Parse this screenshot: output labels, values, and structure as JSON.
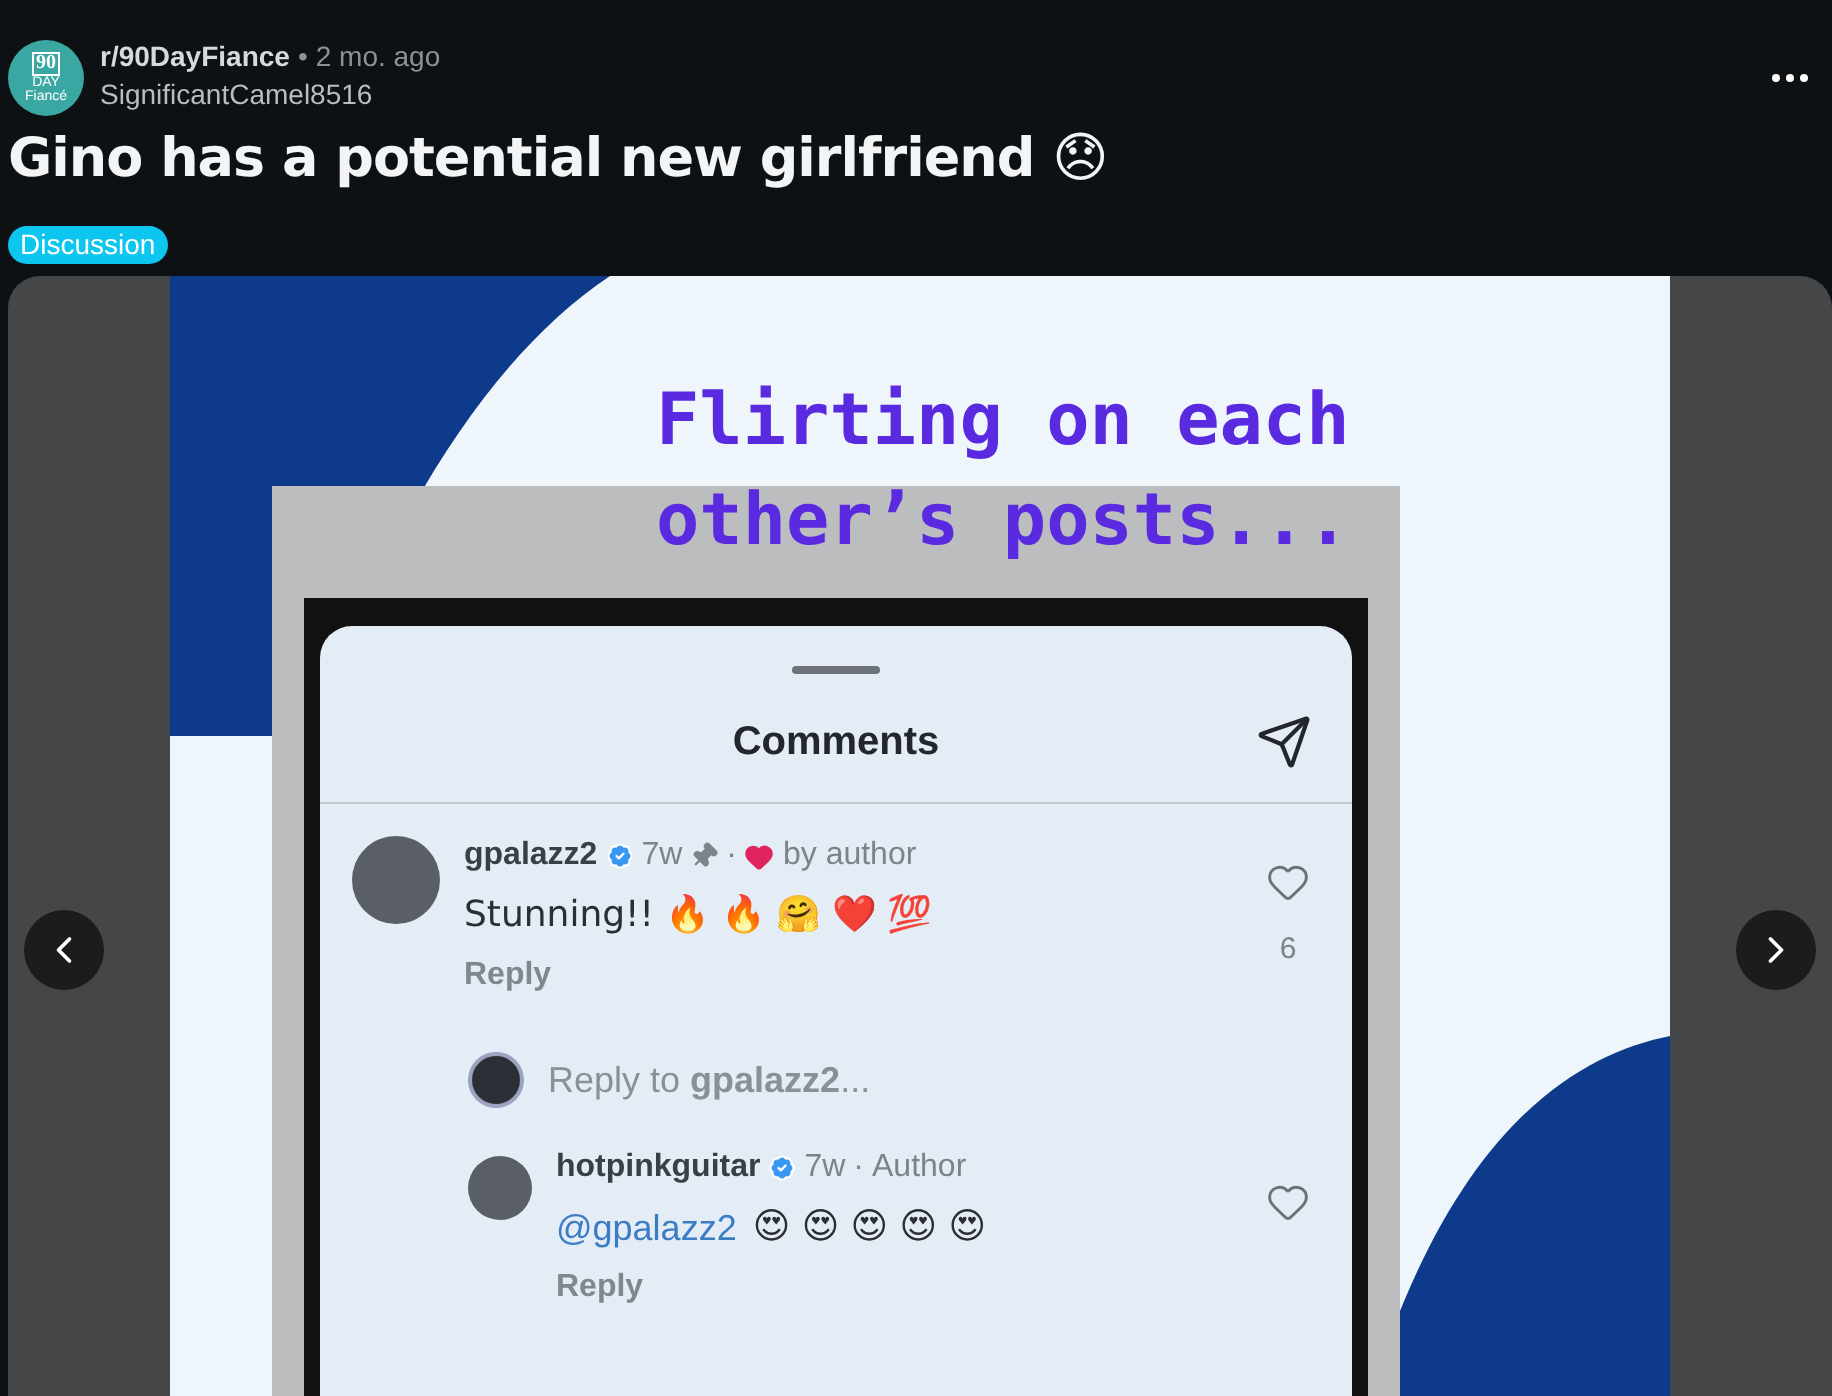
{
  "post": {
    "community_icon": {
      "lines": [
        "90",
        "DAY",
        "Fiancé"
      ]
    },
    "subreddit": "r/90DayFiance",
    "separator": "•",
    "time": "2 mo. ago",
    "author": "SignificantCamel8516",
    "title": "Gino has a potential new girlfriend 😞",
    "flair": "Discussion"
  },
  "carousel": {
    "headline": [
      "Flirting on each",
      "other’s posts..."
    ],
    "sheet": {
      "title": "Comments",
      "items": [
        {
          "kind": "comment",
          "user": "gpalazz2",
          "verified": true,
          "time": "7w",
          "pinned": true,
          "separator": "·",
          "liked_by_author": true,
          "label": "by author",
          "text": "Stunning!! 🔥 🔥 🤗 ❤️ 💯",
          "action": "Reply",
          "like_count": "6"
        },
        {
          "kind": "reply_field",
          "placeholder": "Reply to **gpalazz2**..."
        },
        {
          "kind": "reply",
          "user": "hotpinkguitar",
          "verified": true,
          "time": "7w",
          "pinned": false,
          "separator": "·",
          "liked_by_author": false,
          "label": "Author",
          "mention": "@gpalazz2",
          "text": "😍 😍 😍 😍 😍",
          "action": "Reply"
        }
      ]
    }
  }
}
